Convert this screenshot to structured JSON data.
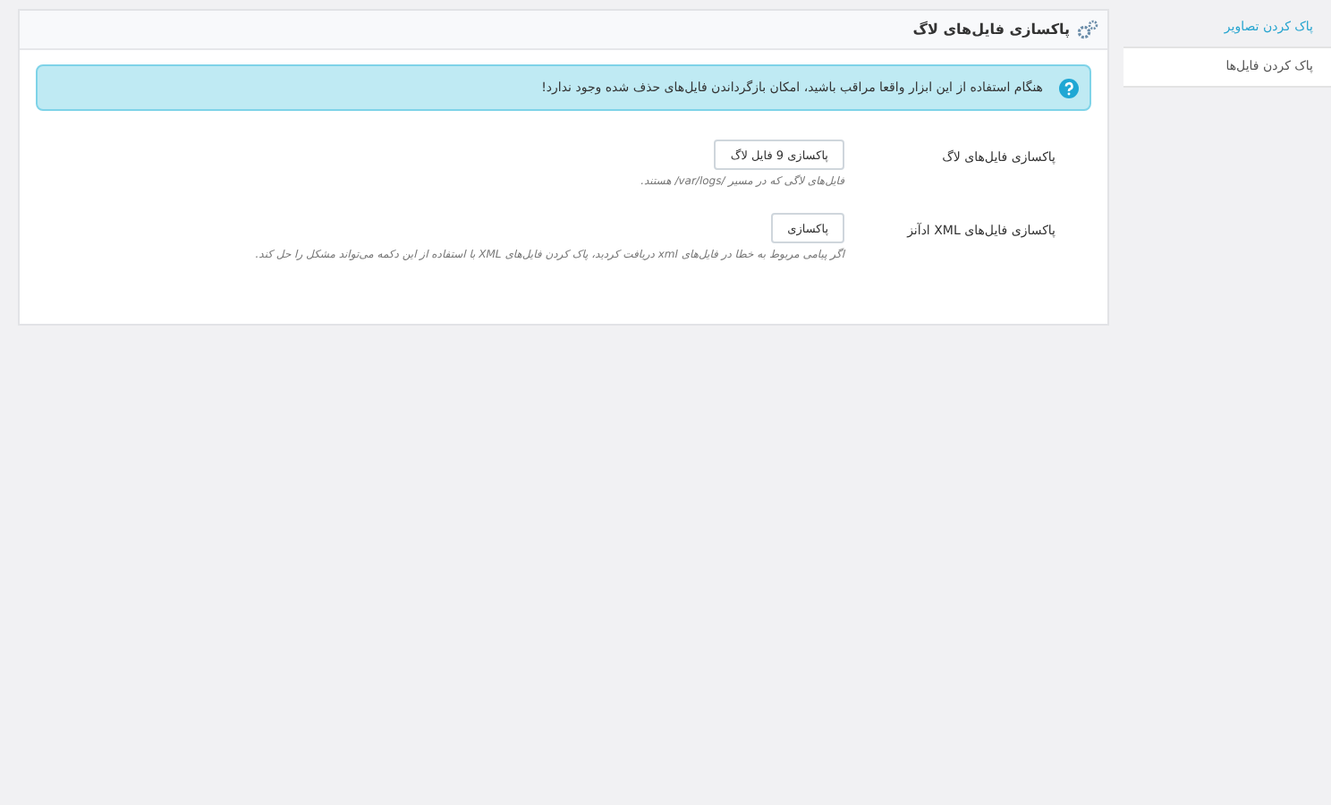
{
  "sidebar": {
    "items": [
      {
        "label": "پاک کردن تصاویر",
        "selected": false
      },
      {
        "label": "پاک کردن فایل‌ها",
        "selected": true
      }
    ]
  },
  "panel": {
    "title": "پاکسازی فایل‌های لاگ",
    "notice": "هنگام استفاده از این ابزار واقعا مراقب باشید، امکان بازگرداندن فایل‌های حذف شده وجود ندارد!",
    "rows": [
      {
        "label": "پاکسازی فایل‌های لاگ",
        "button": "پاکسازی 9 فایل لاگ",
        "description": "فایل‌های لاگی که در مسیر /var/logs/ هستند."
      },
      {
        "label": "پاکسازی فایل‌های XML ادآنز",
        "button": "پاکسازی",
        "description": "اگر پیامی مربوط به خطا در فایل‌های xml دریافت کردید، پاک کردن فایل‌های XML با استفاده از این دکمه می‌تواند مشکل را حل کند."
      }
    ]
  }
}
